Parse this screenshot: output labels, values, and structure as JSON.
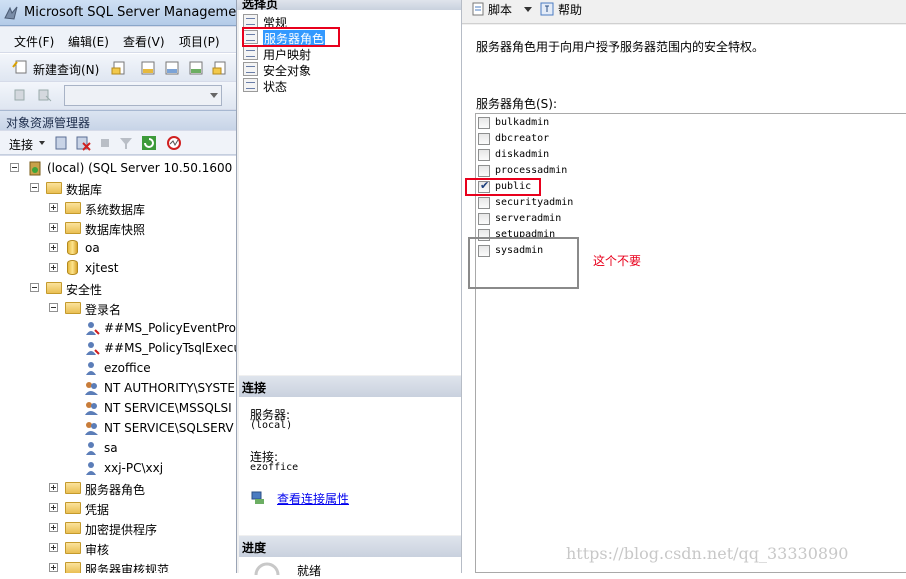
{
  "ssms": {
    "title": "Microsoft SQL Server Management",
    "menu": [
      "文件(F)",
      "编辑(E)",
      "查看(V)",
      "项目(P)"
    ],
    "toolbar": {
      "new_query_label": "新建查询(N)"
    },
    "object_explorer": {
      "title": "对象资源管理器",
      "connect_label": "连接",
      "tree": [
        {
          "label": "(local) (SQL Server 10.50.1600 -",
          "icon": "server-icon"
        },
        {
          "label": "数据库",
          "icon": "folder-icon"
        },
        {
          "label": "系统数据库",
          "icon": "folder-icon"
        },
        {
          "label": "数据库快照",
          "icon": "folder-icon"
        },
        {
          "label": "oa",
          "icon": "database-icon"
        },
        {
          "label": "xjtest",
          "icon": "database-icon"
        },
        {
          "label": "安全性",
          "icon": "folder-icon"
        },
        {
          "label": "登录名",
          "icon": "folder-icon"
        },
        {
          "label": "##MS_PolicyEventProc",
          "icon": "login-icon"
        },
        {
          "label": "##MS_PolicyTsqlExecu",
          "icon": "login-icon"
        },
        {
          "label": "ezoffice",
          "icon": "login-icon"
        },
        {
          "label": "NT AUTHORITY\\SYSTE",
          "icon": "login-group-icon"
        },
        {
          "label": "NT SERVICE\\MSSQLSI",
          "icon": "login-group-icon"
        },
        {
          "label": "NT SERVICE\\SQLSERV",
          "icon": "login-group-icon"
        },
        {
          "label": "sa",
          "icon": "login-icon"
        },
        {
          "label": "xxj-PC\\xxj",
          "icon": "login-icon"
        },
        {
          "label": "服务器角色",
          "icon": "folder-icon"
        },
        {
          "label": "凭据",
          "icon": "folder-icon"
        },
        {
          "label": "加密提供程序",
          "icon": "folder-icon"
        },
        {
          "label": "审核",
          "icon": "folder-icon"
        },
        {
          "label": "服务器审核规范",
          "icon": "folder-icon"
        }
      ]
    }
  },
  "dialog": {
    "select_page_header": "选择页",
    "pages": [
      {
        "label": "常规",
        "selected": false
      },
      {
        "label": "服务器角色",
        "selected": true
      },
      {
        "label": "用户映射",
        "selected": false
      },
      {
        "label": "安全对象",
        "selected": false
      },
      {
        "label": "状态",
        "selected": false
      }
    ],
    "connection": {
      "header": "连接",
      "server_label": "服务器:",
      "server_value": "(local)",
      "conn_label": "连接:",
      "conn_value": "ezoffice",
      "view_props_link": "查看连接属性"
    },
    "progress": {
      "header": "进度",
      "status": "就绪"
    },
    "toolbar": {
      "script_label": "脚本",
      "help_label": "帮助"
    },
    "description": "服务器角色用于向用户授予服务器范围内的安全特权。",
    "roles_label": "服务器角色(S):",
    "roles": [
      {
        "name": "bulkadmin",
        "checked": false
      },
      {
        "name": "dbcreator",
        "checked": false
      },
      {
        "name": "diskadmin",
        "checked": false
      },
      {
        "name": "processadmin",
        "checked": false
      },
      {
        "name": "public",
        "checked": true
      },
      {
        "name": "securityadmin",
        "checked": false
      },
      {
        "name": "serveradmin",
        "checked": false
      },
      {
        "name": "setupadmin",
        "checked": false
      },
      {
        "name": "sysadmin",
        "checked": false
      }
    ]
  },
  "annotation": "这个不要",
  "watermark": "https://blog.csdn.net/qq_33330890",
  "colors": {
    "highlight_box": "#e8001c",
    "gray_box": "#8a8a8a",
    "selection": "#3399ff"
  }
}
